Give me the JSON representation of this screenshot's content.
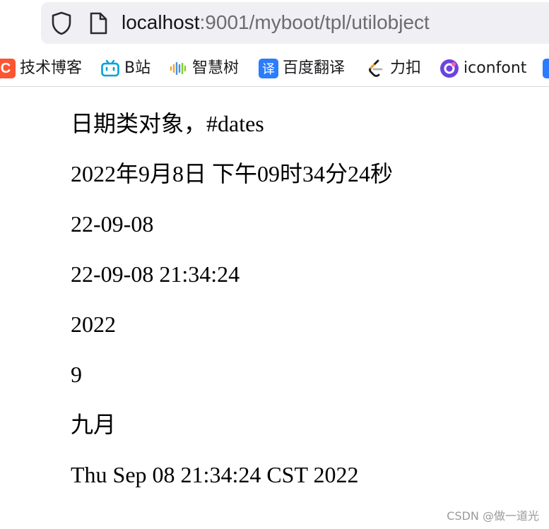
{
  "browser": {
    "url_host": "localhost",
    "url_path": ":9001/myboot/tpl/utilobject"
  },
  "bookmarks": [
    {
      "label": "技术博客",
      "icon": "csdn-c-icon",
      "color": "#fc5531"
    },
    {
      "label": "B站",
      "icon": "bilibili-tv-icon",
      "color": "#00a1d6"
    },
    {
      "label": "智慧树",
      "icon": "soundwave-icon",
      "color": "#f5a623"
    },
    {
      "label": "百度翻译",
      "icon": "translate-icon",
      "color": "#2b7cff"
    },
    {
      "label": "力扣",
      "icon": "leetcode-icon",
      "color": "#ffa116"
    },
    {
      "label": "iconfont",
      "icon": "iconfont-icon",
      "color": "#6c43e0"
    }
  ],
  "content": {
    "lines": [
      "日期类对象，#dates",
      "2022年9月8日 下午09时34分24秒",
      "22-09-08",
      "22-09-08 21:34:24",
      "2022",
      "9",
      "九月",
      "Thu Sep 08 21:34:24 CST 2022"
    ]
  },
  "watermark": "CSDN @做一道光"
}
